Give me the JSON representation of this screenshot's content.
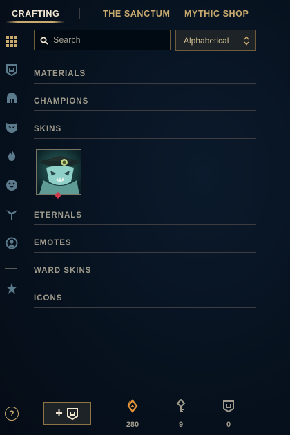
{
  "nav": {
    "tabs": [
      {
        "label": "CRAFTING",
        "active": true
      },
      {
        "label": "THE SANCTUM",
        "active": false
      },
      {
        "label": "MYTHIC SHOP",
        "active": false
      }
    ]
  },
  "sidebar": {
    "items": [
      {
        "icon": "grid-icon"
      },
      {
        "icon": "chest-icon"
      },
      {
        "icon": "helmet-icon"
      },
      {
        "icon": "mask-icon"
      },
      {
        "icon": "flame-icon"
      },
      {
        "icon": "emote-face-icon"
      },
      {
        "icon": "ward-icon"
      },
      {
        "icon": "profile-icon"
      },
      {
        "icon": "eternals-icon"
      }
    ]
  },
  "search": {
    "placeholder": "Search",
    "value": ""
  },
  "sort": {
    "selected": "Alphabetical"
  },
  "categories": [
    {
      "label": "MATERIALS"
    },
    {
      "label": "CHAMPIONS"
    },
    {
      "label": "SKINS"
    },
    {
      "label": "ETERNALS"
    },
    {
      "label": "EMOTES"
    },
    {
      "label": "WARD SKINS"
    },
    {
      "label": "ICONS"
    }
  ],
  "footer": {
    "help_label": "?",
    "add_label": "+",
    "currencies": [
      {
        "name": "essence-icon",
        "value": "280"
      },
      {
        "name": "key-icon",
        "value": "9"
      },
      {
        "name": "chest-icon",
        "value": "0"
      }
    ]
  },
  "colors": {
    "gold": "#c8aa6e",
    "gold_light": "#f0e6d2",
    "text_muted": "#a09b8c",
    "orange_essence": "#e8953a",
    "background": "#07121f"
  }
}
